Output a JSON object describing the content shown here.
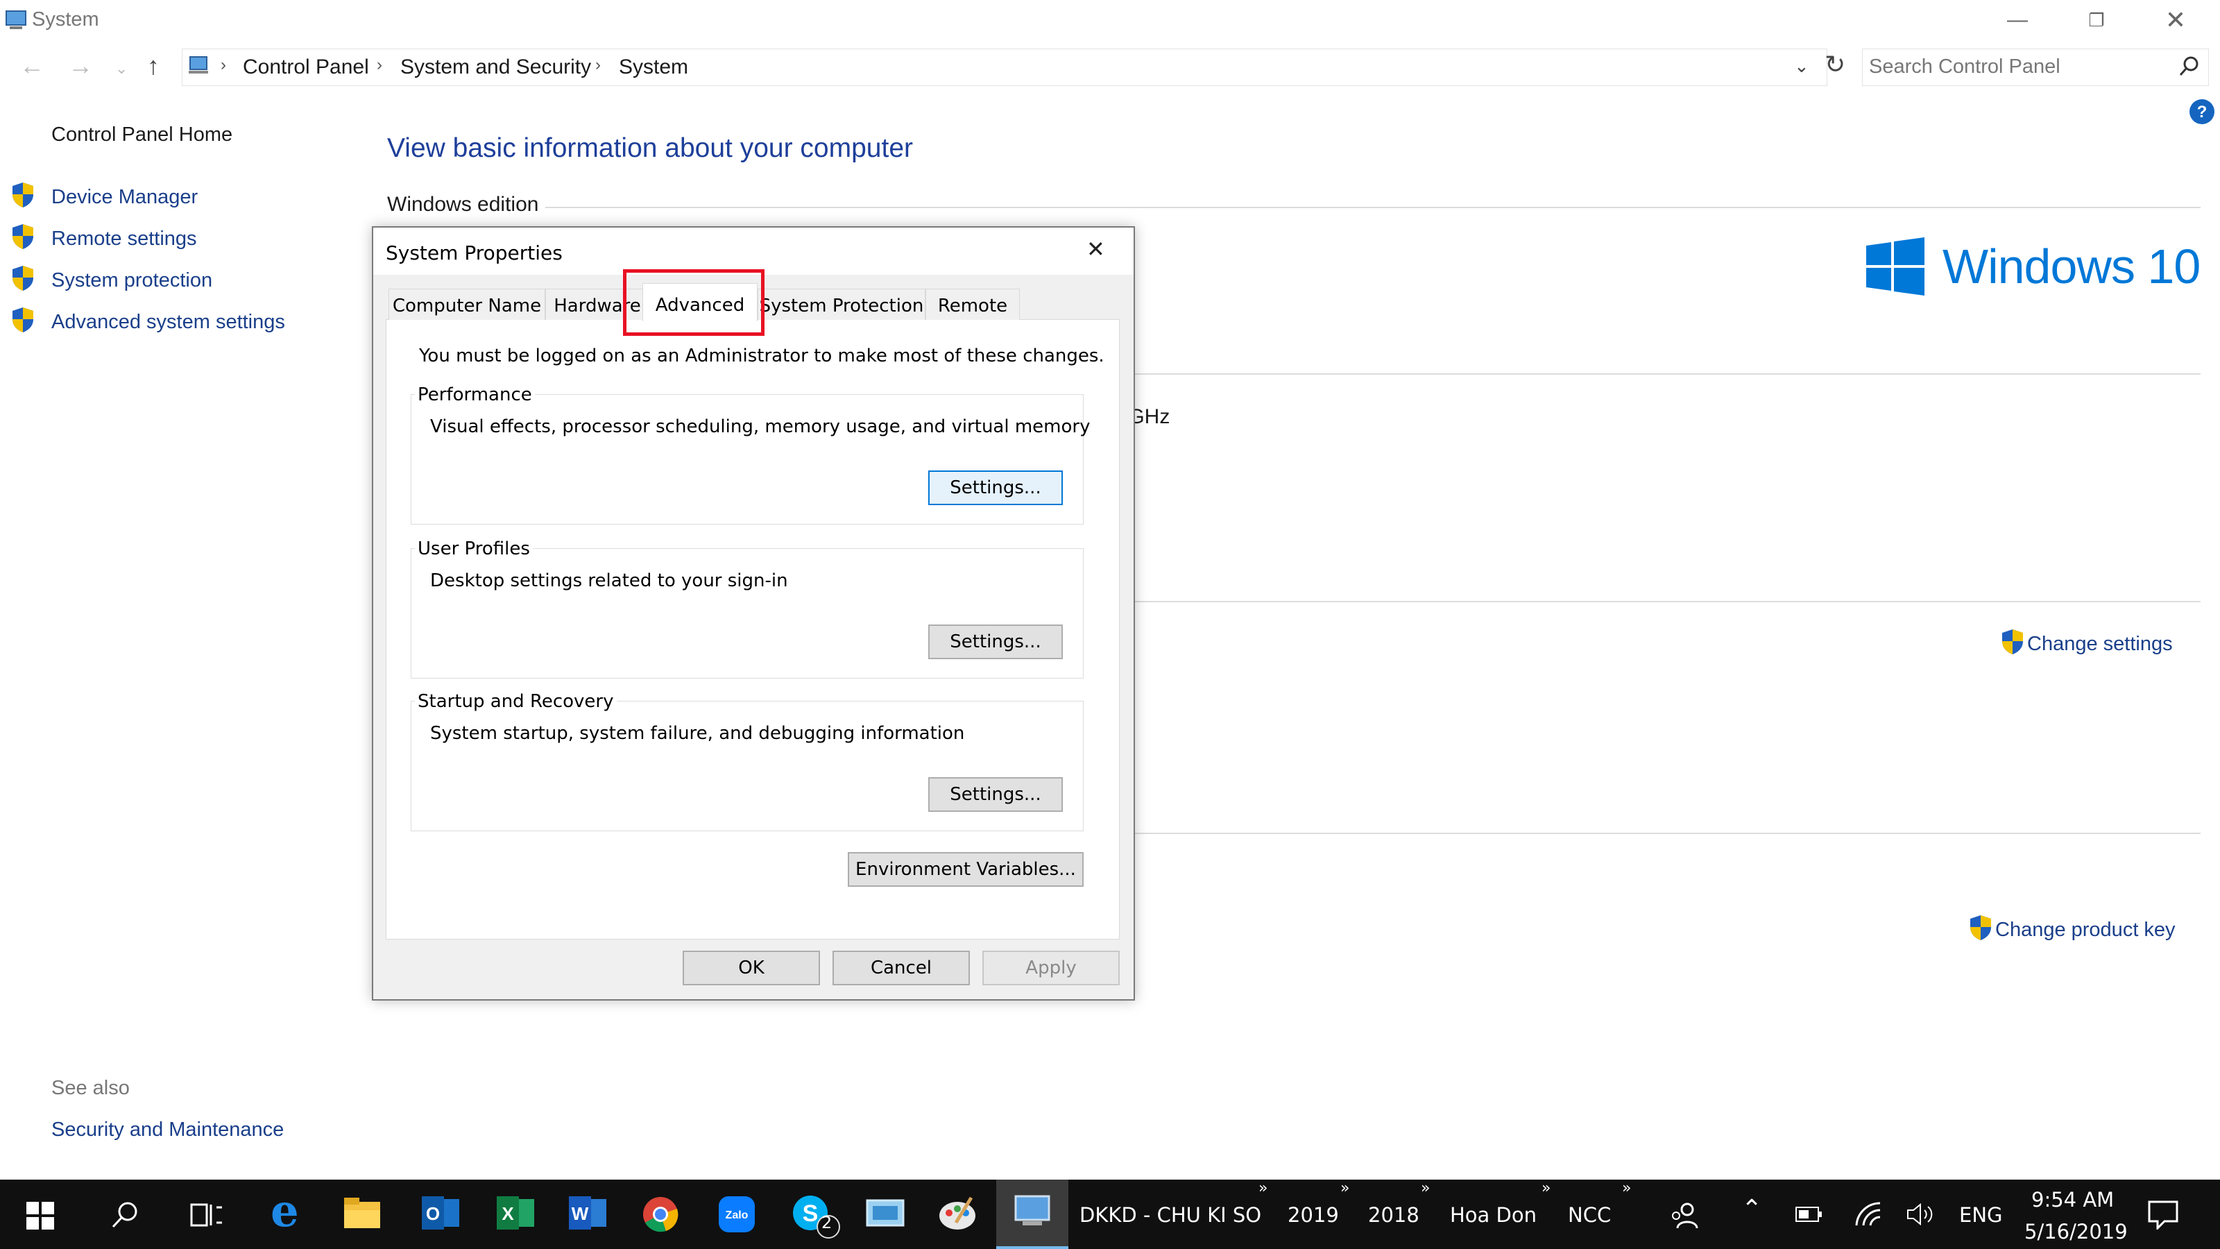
{
  "window": {
    "title": "System"
  },
  "address": {
    "crumbs": [
      "Control Panel",
      "System and Security",
      "System"
    ],
    "search_placeholder": "Search Control Panel"
  },
  "sidebar": {
    "home": "Control Panel Home",
    "items": [
      {
        "label": "Device Manager"
      },
      {
        "label": "Remote settings"
      },
      {
        "label": "System protection"
      },
      {
        "label": "Advanced system settings"
      }
    ],
    "see_also": "See also",
    "see_also_link": "Security and Maintenance"
  },
  "main": {
    "title": "View basic information about your computer",
    "edition_heading": "Windows edition",
    "logo_text": "Windows 10",
    "partial_text": ") GHz",
    "change_settings": "Change settings",
    "change_product_key": "Change product key"
  },
  "dialog": {
    "title": "System Properties",
    "tabs": [
      "Computer Name",
      "Hardware",
      "Advanced",
      "System Protection",
      "Remote"
    ],
    "admin_note": "You must be logged on as an Administrator to make most of these changes.",
    "groups": [
      {
        "title": "Performance",
        "desc": "Visual effects, processor scheduling, memory usage, and virtual memory",
        "button": "Settings..."
      },
      {
        "title": "User Profiles",
        "desc": "Desktop settings related to your sign-in",
        "button": "Settings..."
      },
      {
        "title": "Startup and Recovery",
        "desc": "System startup, system failure, and debugging information",
        "button": "Settings..."
      }
    ],
    "env_button": "Environment Variables...",
    "ok": "OK",
    "cancel": "Cancel",
    "apply": "Apply"
  },
  "taskbar": {
    "skype_badge": "2",
    "toolbars": [
      "DKKD - CHU KI SO",
      "2019",
      "2018",
      "Hoa Don",
      "NCC"
    ],
    "lang": "ENG",
    "time": "9:54 AM",
    "date": "5/16/2019"
  },
  "colors": {
    "accent": "#1e3f9a",
    "highlight": "#e81123",
    "win_blue": "#0078d7"
  }
}
